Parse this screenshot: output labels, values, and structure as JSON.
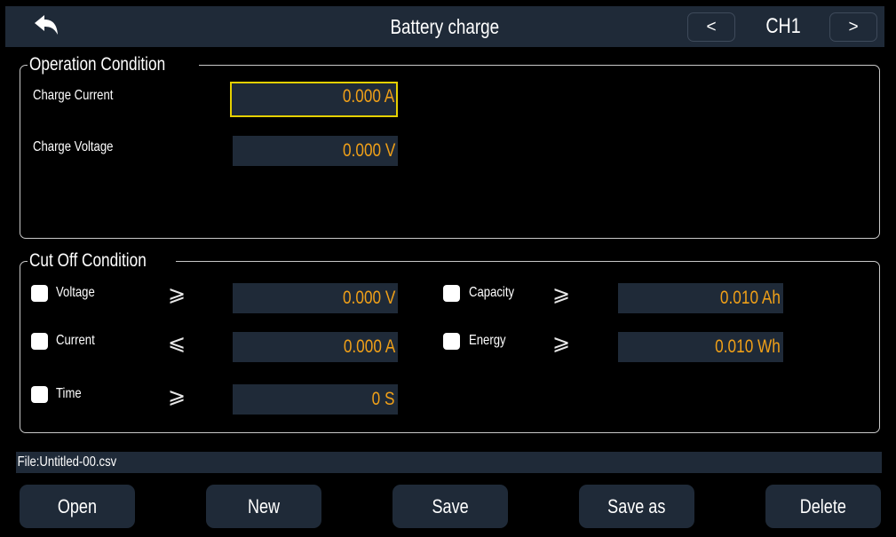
{
  "header": {
    "back_icon": "back-arrow-icon",
    "title": "Battery charge",
    "prev_label": "<",
    "channel": "CH1",
    "next_label": ">"
  },
  "operation": {
    "legend": "Operation Condition",
    "charge_current_label": "Charge Current",
    "charge_current_value": "0.000 A",
    "charge_voltage_label": "Charge Voltage",
    "charge_voltage_value": "0.000 V"
  },
  "cutoff": {
    "legend": "Cut Off Condition",
    "voltage": {
      "label": "Voltage",
      "compare": "⩾",
      "value": "0.000 V",
      "checked": false
    },
    "current": {
      "label": "Current",
      "compare": "⩽",
      "value": "0.000 A",
      "checked": false
    },
    "time": {
      "label": "Time",
      "compare": "⩾",
      "value": "0 S",
      "checked": false
    },
    "capacity": {
      "label": "Capacity",
      "compare": "⩾",
      "value": "0.010 Ah",
      "checked": false
    },
    "energy": {
      "label": "Energy",
      "compare": "⩾",
      "value": "0.010 Wh",
      "checked": false
    }
  },
  "file": {
    "text": "File:Untitled-00.csv"
  },
  "buttons": {
    "open": "Open",
    "new": "New",
    "save": "Save",
    "save_as": "Save as",
    "delete": "Delete"
  },
  "colors": {
    "background": "#000000",
    "panel": "#1f2a38",
    "value_text": "#f0a018",
    "focus_border": "#e6d000"
  }
}
